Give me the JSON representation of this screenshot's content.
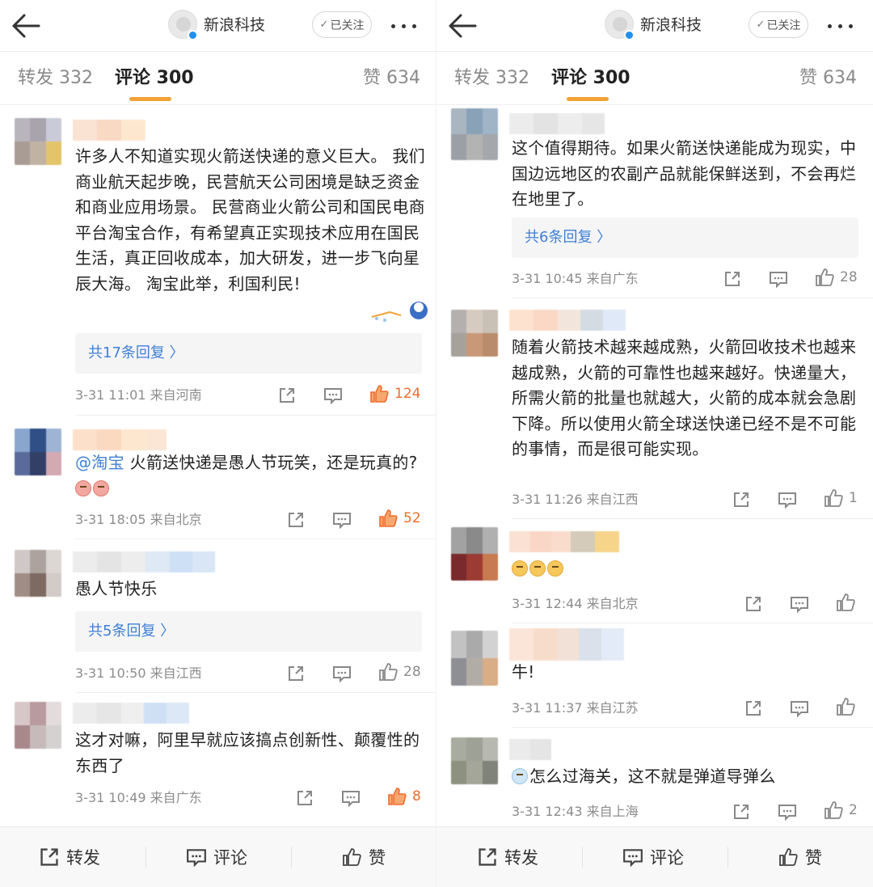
{
  "colors": {
    "accent": "#f0a236",
    "link": "#3f7fd5",
    "hot_like": "#f06b2d",
    "muted": "#8c8c8c"
  },
  "panels": [
    {
      "header": {
        "account_name": "新浪科技",
        "follow_label": "已关注",
        "follow_check_icon": "check-icon"
      },
      "tabs": {
        "repost": "转发 332",
        "comment": "评论 300",
        "like": "赞 634"
      },
      "comments": [
        {
          "text": "许多人不知道实现火箭送快递的意义巨大。 我们商业航天起步晚，民营航天公司困境是缺乏资金和商业应用场景。 民营商业火箭公司和国民电商平台淘宝合作，有希望真正实现技术应用在国民生活，真正回收成本，加大研发，进一步飞向星辰大海。 淘宝此举，利国利民!",
          "replies": "共17条回复 〉",
          "meta": "3-31 11:01  来自河南",
          "likes": "124",
          "liked": true
        },
        {
          "mention": "@淘宝",
          "text": " 火箭送快递是愚人节玩笑，还是玩真的?",
          "meta": "3-31 18:05  来自北京",
          "likes": "52",
          "liked": true
        },
        {
          "text": "愚人节快乐",
          "replies": "共5条回复 〉",
          "meta": "3-31 10:50  来自江西",
          "likes": "28",
          "liked": false
        },
        {
          "text": "这才对嘛，阿里早就应该搞点创新性、颠覆性的东西了",
          "meta": "3-31 10:49  来自广东",
          "likes": "8",
          "liked": true
        }
      ],
      "bottom": {
        "repost": "转发",
        "comment": "评论",
        "like": "赞"
      }
    },
    {
      "header": {
        "account_name": "新浪科技",
        "follow_label": "已关注",
        "follow_check_icon": "check-icon"
      },
      "tabs": {
        "repost": "转发 332",
        "comment": "评论 300",
        "like": "赞 634"
      },
      "comments": [
        {
          "text": "这个值得期待。如果火箭送快递能成为现实，中国边远地区的农副产品就能保鲜送到，不会再烂在地里了。",
          "replies": "共6条回复 〉",
          "meta": "3-31 10:45  来自广东",
          "likes": "28",
          "liked": false
        },
        {
          "text": "随着火箭技术越来越成熟，火箭回收技术也越来越成熟，火箭的可靠性也越来越好。快递量大，所需火箭的批量也就越大，火箭的成本就会急剧下降。所以使用火箭全球送快递已经不是不可能的事情，而是很可能实现。",
          "meta": "3-31 11:26  来自江西",
          "likes": "1",
          "liked": false
        },
        {
          "text": "",
          "meta": "3-31 12:44  来自北京",
          "likes": "",
          "liked": false
        },
        {
          "text": "牛!",
          "meta": "3-31 11:37  来自江苏",
          "likes": "",
          "liked": false
        },
        {
          "text": "怎么过海关，这不就是弹道导弹么",
          "meta": "3-31 12:43  来自上海",
          "likes": "2",
          "liked": false
        }
      ],
      "bottom": {
        "repost": "转发",
        "comment": "评论",
        "like": "赞"
      }
    }
  ]
}
